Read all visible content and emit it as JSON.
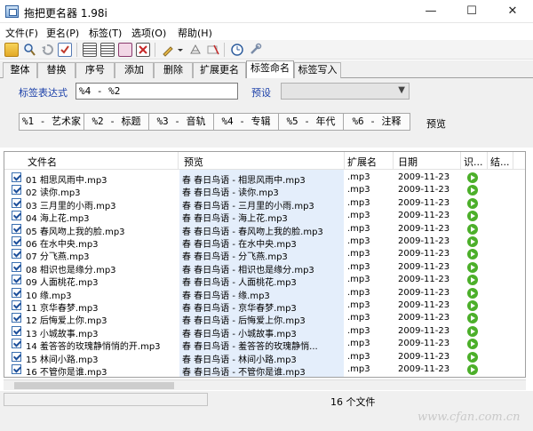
{
  "window": {
    "title": "拖把更名器 1.98i",
    "min": "—",
    "max": "☐",
    "close": "✕"
  },
  "menu": [
    "文件(F)",
    "更名(P)",
    "标签(T)",
    "选项(O)",
    "帮助(H)"
  ],
  "tabs": [
    "整体",
    "替换",
    "序号",
    "添加",
    "删除",
    "扩展更名",
    "标签命名",
    "标签写入"
  ],
  "active_tab": "标签命名",
  "panel": {
    "expr_label": "标签表达式",
    "expr_value": "%4 - %2",
    "preset_label": "预设",
    "preset_value": "",
    "tag_buttons": [
      "%1 - 艺术家",
      "%2 - 标题",
      "%3 - 音轨",
      "%4 - 专辑",
      "%5 - 年代",
      "%6 - 注释"
    ],
    "preview_label": "预览"
  },
  "table": {
    "headers": {
      "name": "文件名",
      "preview": "预览",
      "ext": "扩展名",
      "date": "日期",
      "id": "识...",
      "result": "结..."
    },
    "rows": [
      {
        "name": "01 相思风雨中.mp3",
        "preview": "春 春日鸟语 - 相思风雨中.mp3",
        "ext": ".mp3",
        "date": "2009-11-23"
      },
      {
        "name": "02 读你.mp3",
        "preview": "春 春日鸟语 - 读你.mp3",
        "ext": ".mp3",
        "date": "2009-11-23"
      },
      {
        "name": "03 三月里的小雨.mp3",
        "preview": "春 春日鸟语 - 三月里的小雨.mp3",
        "ext": ".mp3",
        "date": "2009-11-23"
      },
      {
        "name": "04 海上花.mp3",
        "preview": "春 春日鸟语 - 海上花.mp3",
        "ext": ".mp3",
        "date": "2009-11-23"
      },
      {
        "name": "05 春风吻上我的脸.mp3",
        "preview": "春 春日鸟语 - 春风吻上我的脸.mp3",
        "ext": ".mp3",
        "date": "2009-11-23"
      },
      {
        "name": "06 在水中央.mp3",
        "preview": "春 春日鸟语 - 在水中央.mp3",
        "ext": ".mp3",
        "date": "2009-11-23"
      },
      {
        "name": "07 分飞燕.mp3",
        "preview": "春 春日鸟语 - 分飞燕.mp3",
        "ext": ".mp3",
        "date": "2009-11-23"
      },
      {
        "name": "08 相识也是缘分.mp3",
        "preview": "春 春日鸟语 - 相识也是缘分.mp3",
        "ext": ".mp3",
        "date": "2009-11-23"
      },
      {
        "name": "09 人面桃花.mp3",
        "preview": "春 春日鸟语 - 人面桃花.mp3",
        "ext": ".mp3",
        "date": "2009-11-23"
      },
      {
        "name": "10 缘.mp3",
        "preview": "春 春日鸟语 - 缘.mp3",
        "ext": ".mp3",
        "date": "2009-11-23"
      },
      {
        "name": "11 京华春梦.mp3",
        "preview": "春 春日鸟语 - 京华春梦.mp3",
        "ext": ".mp3",
        "date": "2009-11-23"
      },
      {
        "name": "12 后悔爱上你.mp3",
        "preview": "春 春日鸟语 - 后悔爱上你.mp3",
        "ext": ".mp3",
        "date": "2009-11-23"
      },
      {
        "name": "13 小城故事.mp3",
        "preview": "春 春日鸟语 - 小城故事.mp3",
        "ext": ".mp3",
        "date": "2009-11-23"
      },
      {
        "name": "14 羞答答的玫瑰静悄悄的开.mp3",
        "preview": "春 春日鸟语 - 羞答答的玫瑰静悄...",
        "ext": ".mp3",
        "date": "2009-11-23"
      },
      {
        "name": "15 林间小路.mp3",
        "preview": "春 春日鸟语 - 林间小路.mp3",
        "ext": ".mp3",
        "date": "2009-11-23"
      },
      {
        "name": "16 不管你是谁.mp3",
        "preview": "春 春日鸟语 - 不管你是谁.mp3",
        "ext": ".mp3",
        "date": "2009-11-23"
      }
    ]
  },
  "status": {
    "file_count": "16 个文件"
  },
  "watermark": "www.cfan.com.cn",
  "toolbar_icons": [
    "open-folder-icon",
    "search-icon",
    "undo-icon",
    "check-icon",
    "list-icon",
    "list-icon",
    "rename-icon",
    "cancel-icon",
    "brush-icon",
    "dropdown-icon",
    "clear-icon",
    "tag-icon",
    "clock-icon",
    "wrench-icon"
  ]
}
